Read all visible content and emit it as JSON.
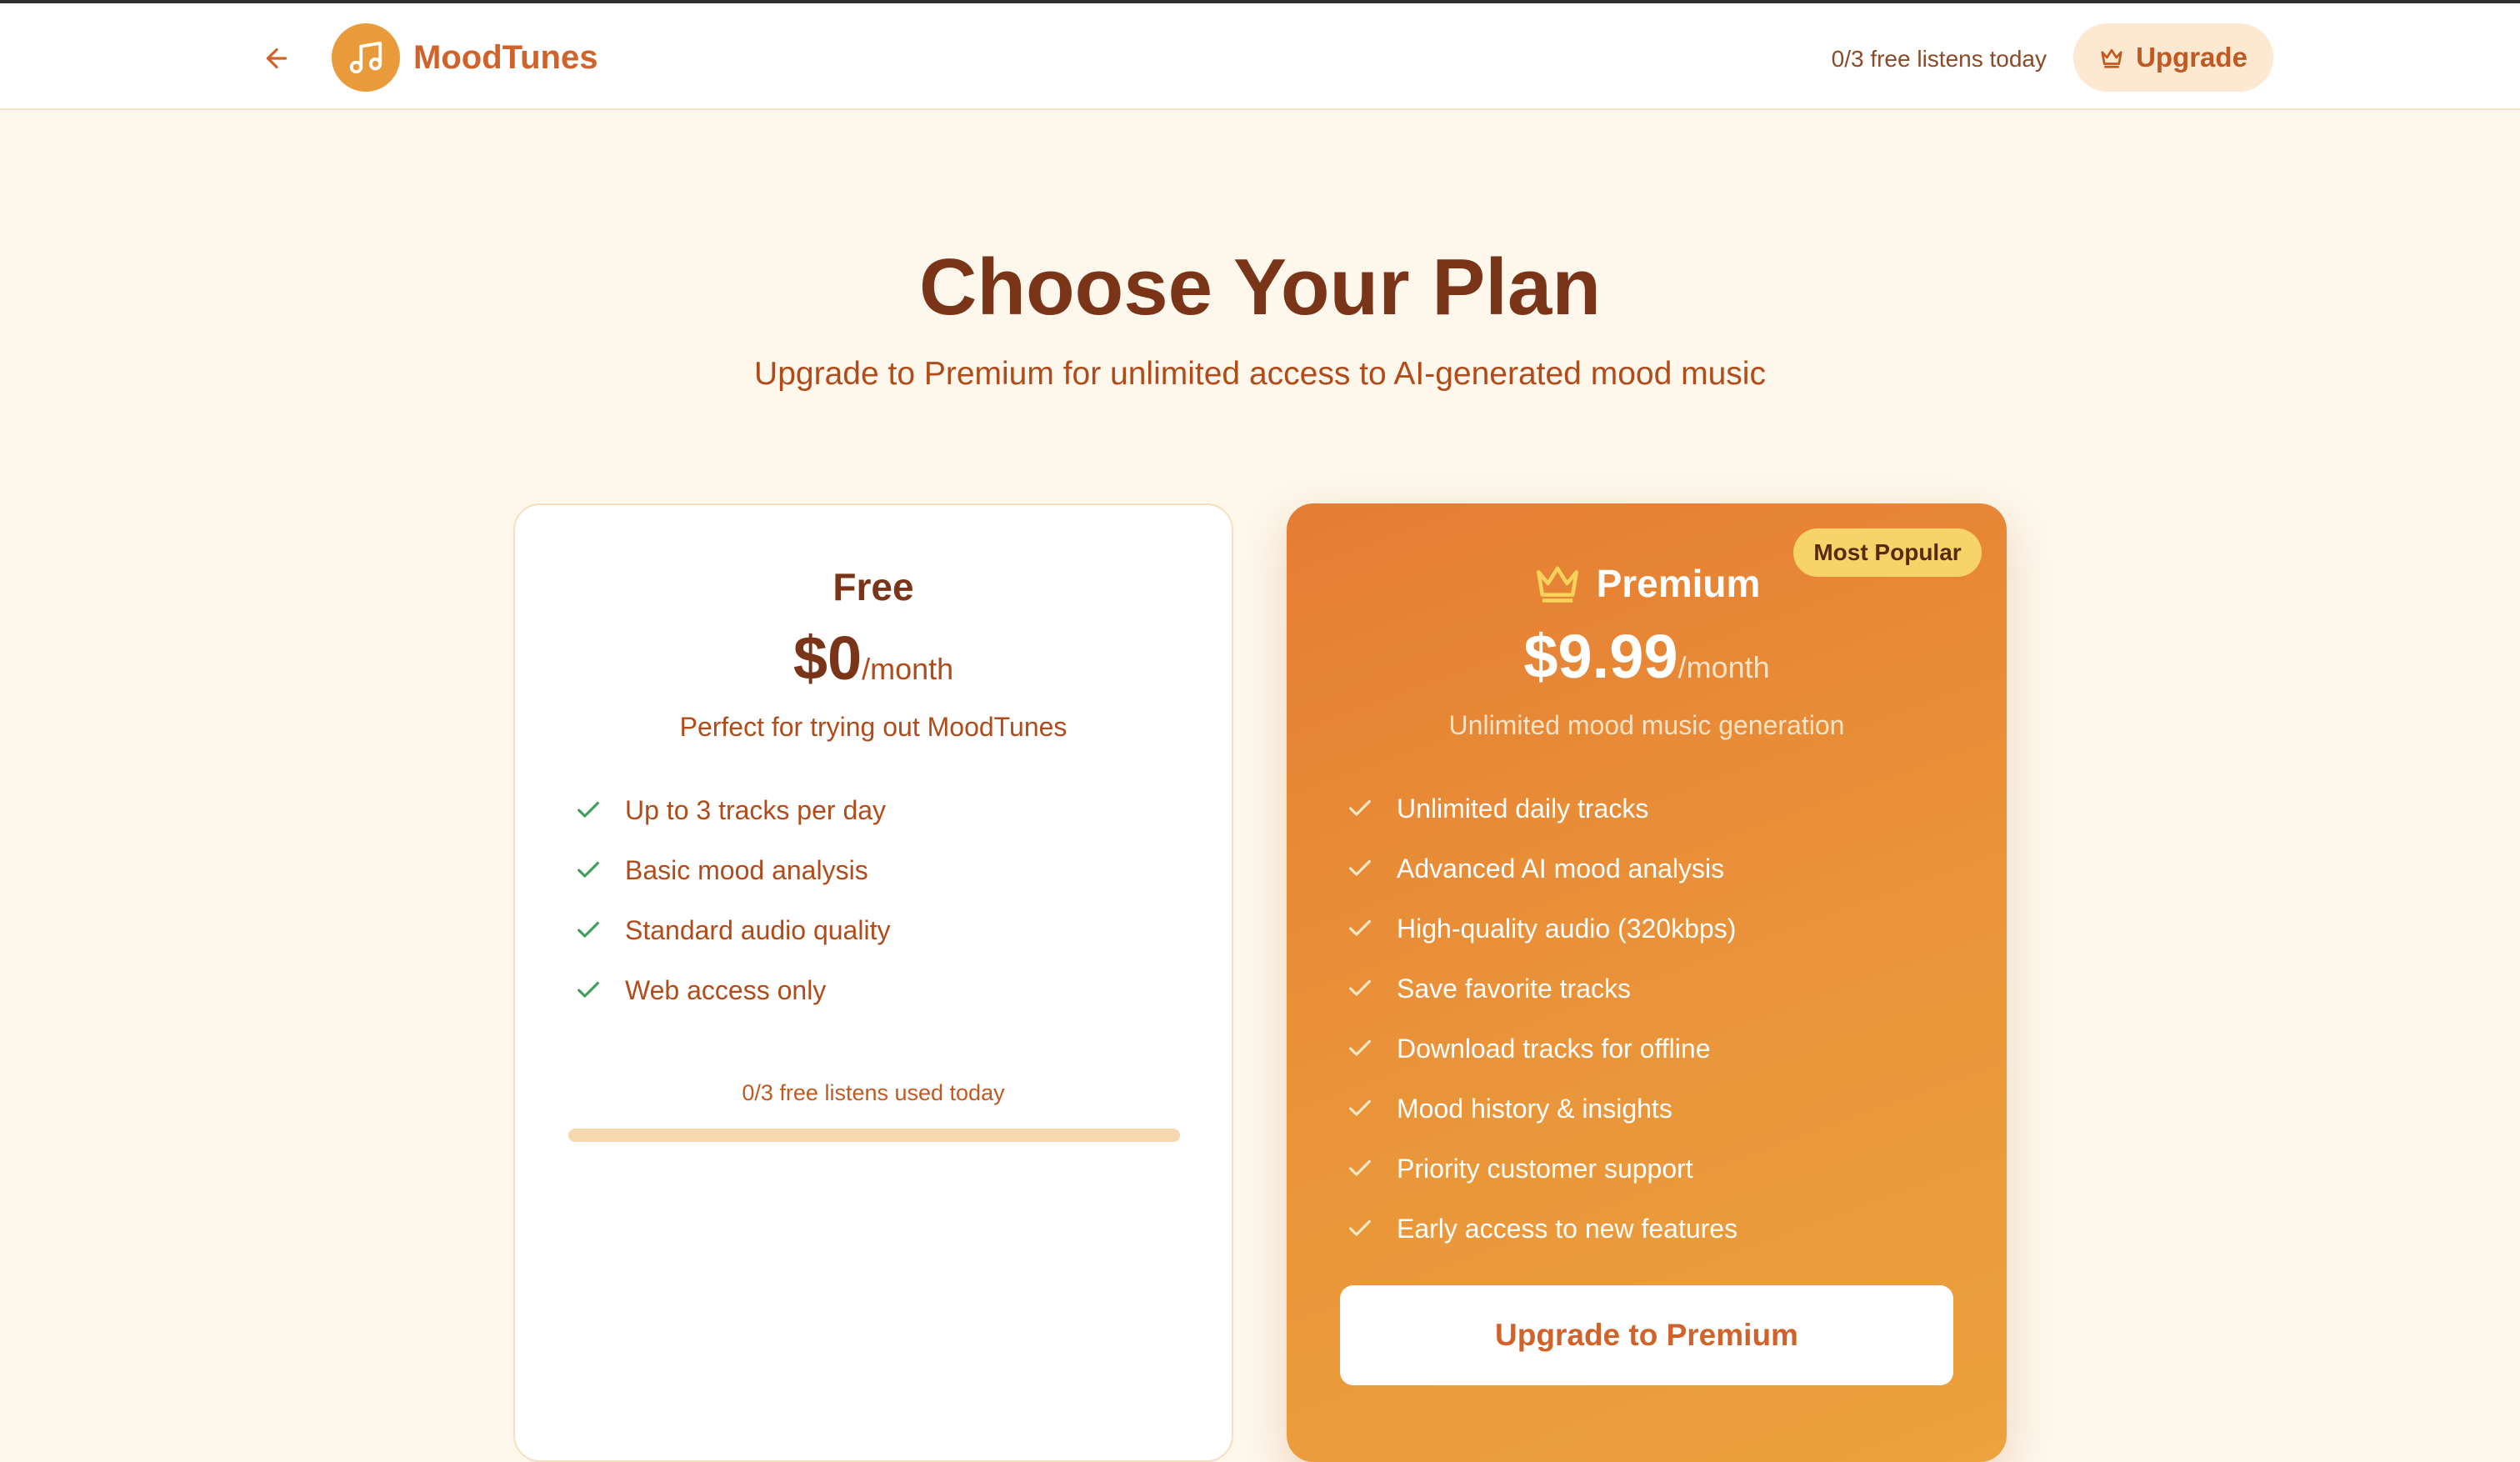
{
  "header": {
    "brand": "MoodTunes",
    "listens_status": "0/3 free listens today",
    "upgrade_label": "Upgrade"
  },
  "hero": {
    "title": "Choose Your Plan",
    "subtitle": "Upgrade to Premium for unlimited access to AI-generated mood music"
  },
  "plans": {
    "free": {
      "name": "Free",
      "price": "$0",
      "period": "/month",
      "description": "Perfect for trying out MoodTunes",
      "features": [
        "Up to 3 tracks per day",
        "Basic mood analysis",
        "Standard audio quality",
        "Web access only"
      ],
      "usage_text": "0/3 free listens used today",
      "usage_progress": 0
    },
    "premium": {
      "badge": "Most Popular",
      "name": "Premium",
      "price": "$9.99",
      "period": "/month",
      "description": "Unlimited mood music generation",
      "features": [
        "Unlimited daily tracks",
        "Advanced AI mood analysis",
        "High-quality audio (320kbps)",
        "Save favorite tracks",
        "Download tracks for offline",
        "Mood history & insights",
        "Priority customer support",
        "Early access to new features"
      ],
      "cta_label": "Upgrade to Premium"
    }
  },
  "icons": {
    "back": "arrow-left-icon",
    "logo": "music-note-icon",
    "upgrade": "crown-icon",
    "feature": "check-icon"
  },
  "colors": {
    "accent": "#d0622a",
    "heading": "#7a3418",
    "page_bg": "#fdf7ec",
    "badge": "#f7d36a",
    "check_free": "#3f9d5b",
    "premium_gradient_start": "#e57d33",
    "premium_gradient_end": "#eca23d"
  }
}
